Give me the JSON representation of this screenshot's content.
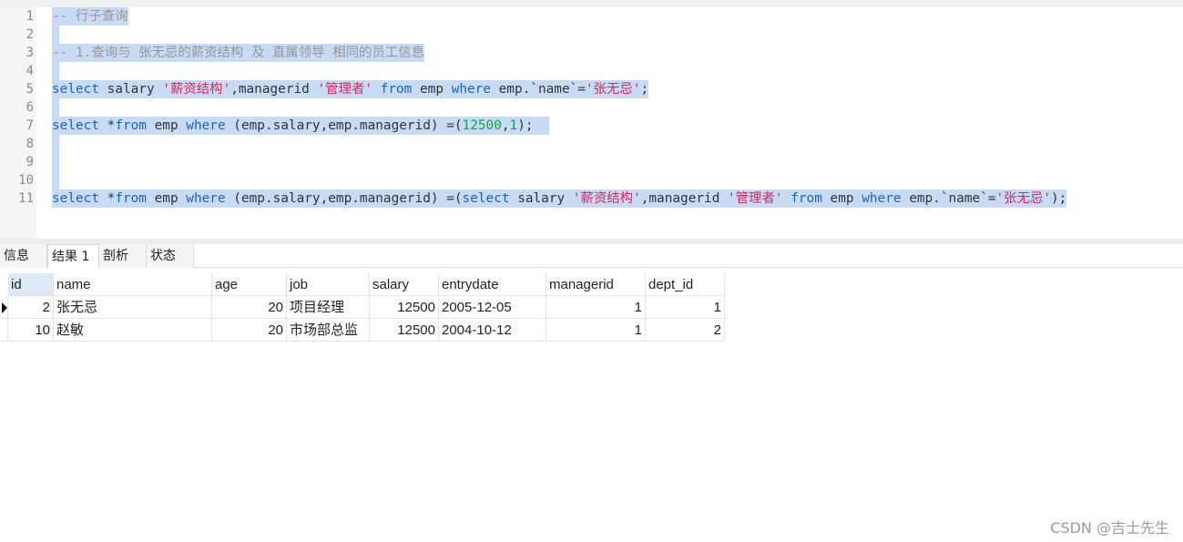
{
  "editor": {
    "line_numbers": [
      "1",
      "2",
      "3",
      "4",
      "5",
      "6",
      "7",
      "8",
      "9",
      "10",
      "11"
    ],
    "line1": "-- 行子查询",
    "line3": "-- 1.查询与 张无忌的薪资结构 及 直属领导 相同的员工信息",
    "line5": {
      "t1": "select",
      "t2": " salary ",
      "t3": "'薪资结构'",
      "t4": ",managerid ",
      "t5": "'管理者'",
      "t6": " ",
      "t7": "from",
      "t8": " emp ",
      "t9": "where",
      "t10": " emp.`name`=",
      "t11": "'张无忌'",
      "t12": ";"
    },
    "line7": {
      "t1": "select",
      "t2": " *",
      "t3": "from",
      "t4": " emp ",
      "t5": "where",
      "t6": " (emp.salary,emp.managerid) =(",
      "t7": "12500",
      "t8": ",",
      "t9": "1",
      "t10": ");"
    },
    "line11": {
      "t1": "select",
      "t2": " *",
      "t3": "from",
      "t4": " emp ",
      "t5": "where",
      "t6": " (emp.salary,emp.managerid) =(",
      "t7": "select",
      "t8": " salary ",
      "t9": "'薪资结构'",
      "t10": ",managerid ",
      "t11": "'管理者'",
      "t12": " ",
      "t13": "from",
      "t14": " emp ",
      "t15": "where",
      "t16": " emp.`name`=",
      "t17": "'张无忌'",
      "t18": ");"
    }
  },
  "tabs": [
    "信息",
    "结果 1",
    "剖析",
    "状态"
  ],
  "active_tab": "结果 1",
  "results": {
    "columns": [
      "id",
      "name",
      "age",
      "job",
      "salary",
      "entrydate",
      "managerid",
      "dept_id"
    ],
    "rows": [
      [
        "2",
        "张无忌",
        "20",
        "项目经理",
        "12500",
        "2005-12-05",
        "1",
        "1"
      ],
      [
        "10",
        "赵敏",
        "20",
        "市场部总监",
        "12500",
        "2004-10-12",
        "1",
        "2"
      ]
    ]
  },
  "watermark": "CSDN @吉士先生"
}
